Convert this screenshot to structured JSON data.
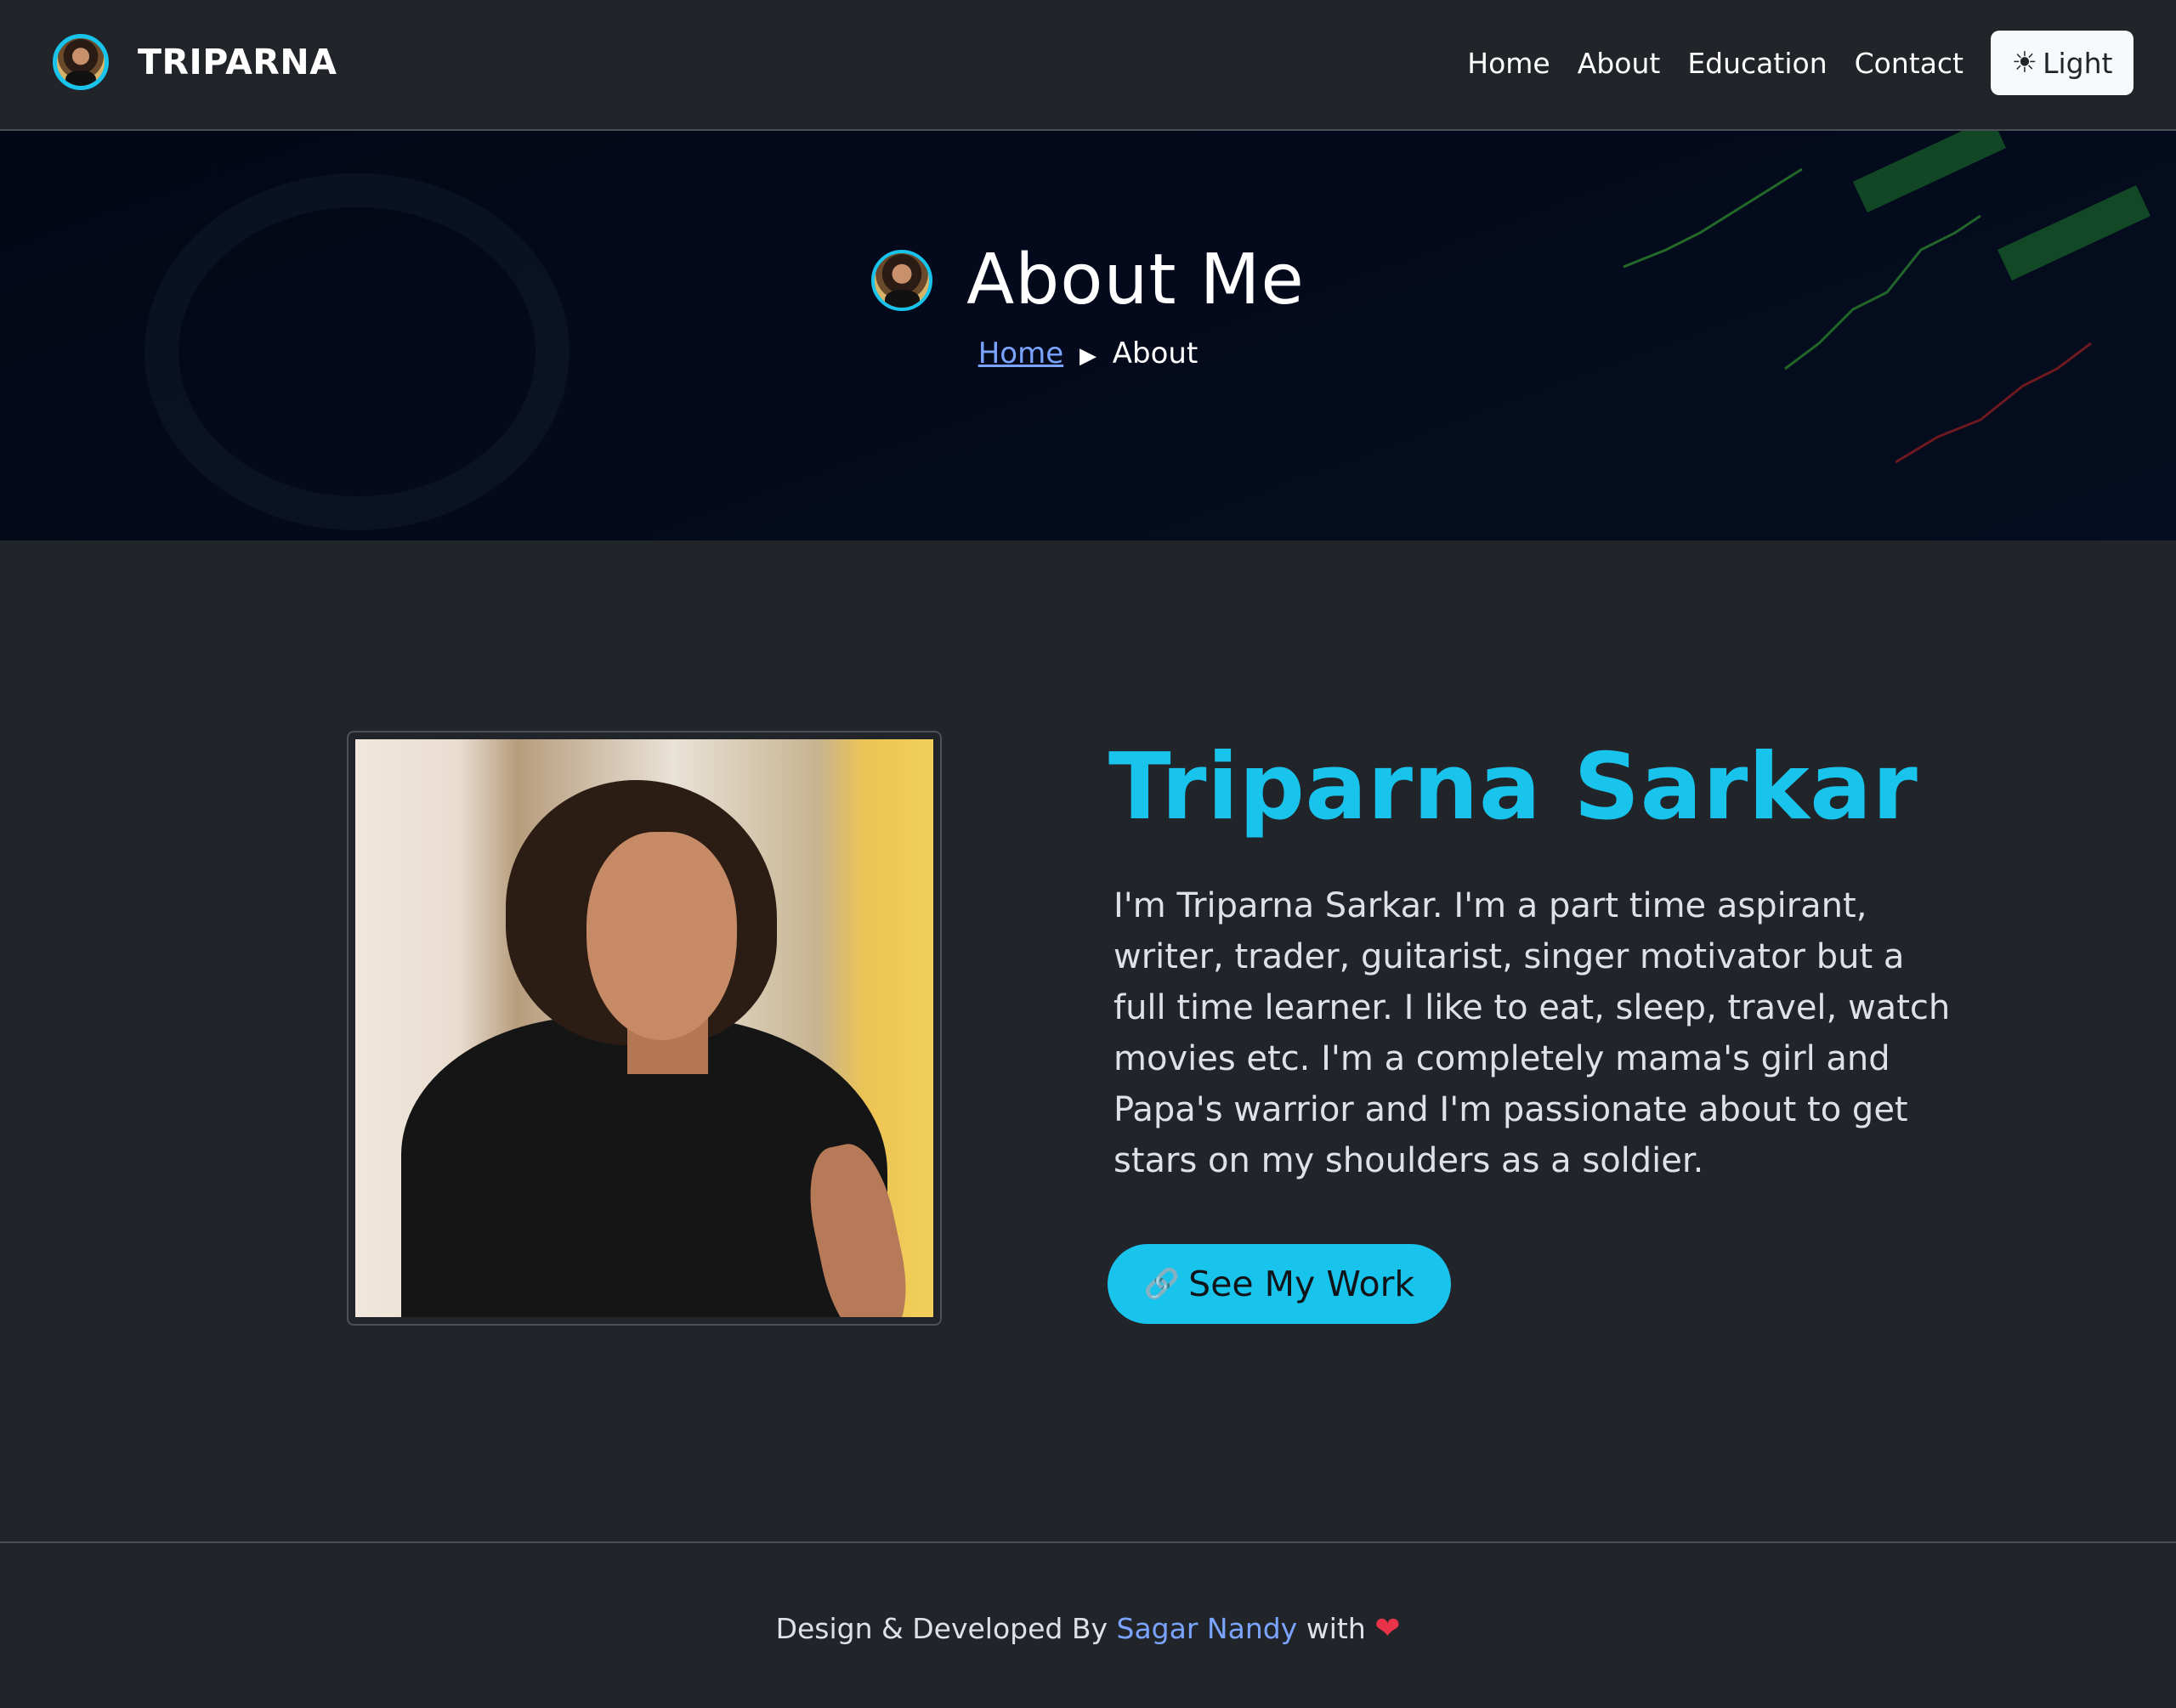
{
  "navbar": {
    "brand_name": "TRIPARNA",
    "links": [
      {
        "label": "Home"
      },
      {
        "label": "About"
      },
      {
        "label": "Education"
      },
      {
        "label": "Contact"
      }
    ],
    "theme_toggle": {
      "icon": "sun-icon",
      "label": "Light"
    }
  },
  "hero": {
    "title": "About Me",
    "breadcrumb": {
      "home": "Home",
      "current": "About"
    }
  },
  "about": {
    "name": "Triparna Sarkar",
    "bio": "I'm Triparna Sarkar. I'm a part time aspirant, writer, trader, guitarist, singer motivator but a full time learner. I like to eat, sleep, travel, watch movies etc. I'm a completely mama's girl and Papa's warrior and I'm passionate about to get stars on my shoulders as a soldier.",
    "cta": {
      "icon": "link-icon",
      "label": "See My Work"
    }
  },
  "footer": {
    "prefix": "Design & Developed By",
    "author": "Sagar Nandy",
    "suffix": "with",
    "icon": "heart-icon"
  },
  "colors": {
    "background": "#212529",
    "accent": "#18c3ec",
    "link": "#7aa4ff",
    "heart": "#e8334a"
  }
}
